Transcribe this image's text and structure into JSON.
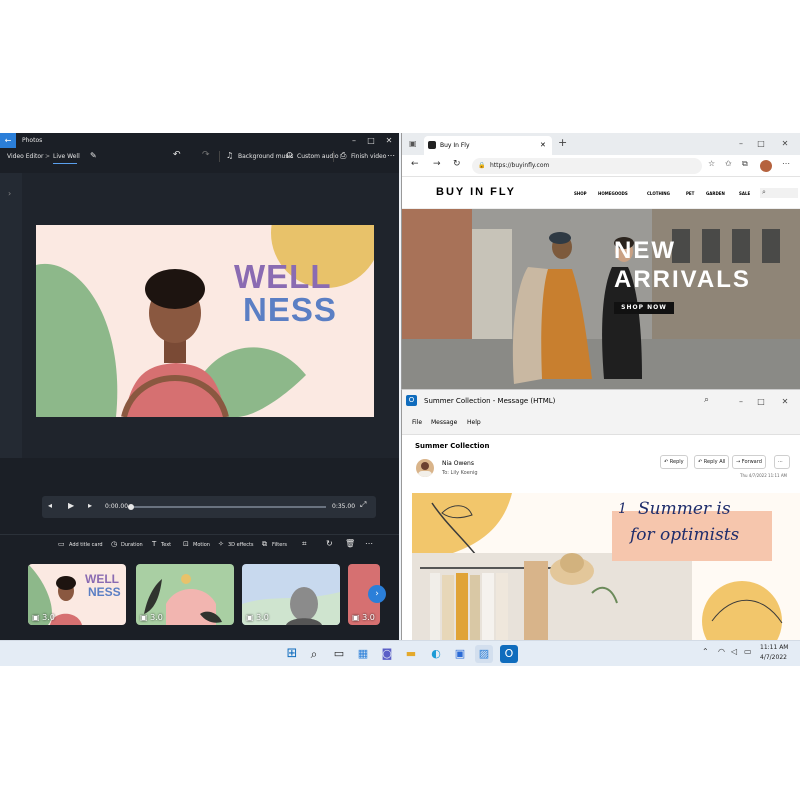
{
  "photos": {
    "title": "Photos",
    "breadcrumb": {
      "root": "Video Editor",
      "sep": ">",
      "project": "Live Well"
    },
    "toolbar": {
      "background_music": "Background music",
      "custom_audio": "Custom audio",
      "finish": "Finish video"
    },
    "stage_text": {
      "line1": "WELL",
      "line2": "NESS"
    },
    "player": {
      "current": "0:00.00",
      "total": "0:35.00"
    },
    "commands": [
      "Add title card",
      "Duration",
      "Text",
      "Motion",
      "3D effects",
      "Filters"
    ],
    "clips": [
      {
        "label": "3.0",
        "text1": "WELL",
        "text2": "NESS"
      },
      {
        "label": "3.0"
      },
      {
        "label": "3.0"
      },
      {
        "label": "3.0"
      }
    ]
  },
  "edge": {
    "tab_title": "Buy In Fly",
    "url": "https://buyinfly.com",
    "site": {
      "logo": "BUY IN FLY",
      "nav": [
        "SHOP",
        "HOMEGOODS",
        "CLOTHING",
        "PET",
        "GARDEN",
        "SALE"
      ],
      "hero": {
        "line1": "NEW",
        "line2": "ARRIVALS",
        "cta": "SHOP NOW"
      }
    }
  },
  "outlook": {
    "title": "Summer Collection - Message (HTML)",
    "menu": [
      "File",
      "Message",
      "Help"
    ],
    "subject": "Summer Collection",
    "sender": "Nia Owens",
    "to": "To: Lily Koenig",
    "actions": {
      "reply": "Reply",
      "reply_all": "Reply All",
      "forward": "Forward"
    },
    "date": "Thu 4/7/2022 11:11 AM",
    "image_text": {
      "num": "1",
      "line1": "Summer is",
      "line2": "for optimists"
    }
  },
  "taskbar": {
    "time": "11:11 AM",
    "date": "4/7/2022"
  },
  "colors": {
    "accent": "#2b7fd9",
    "photos_bg": "#1b1f26",
    "wellness_purple": "#8a6bb2",
    "wellness_green": "#5aa57a"
  }
}
